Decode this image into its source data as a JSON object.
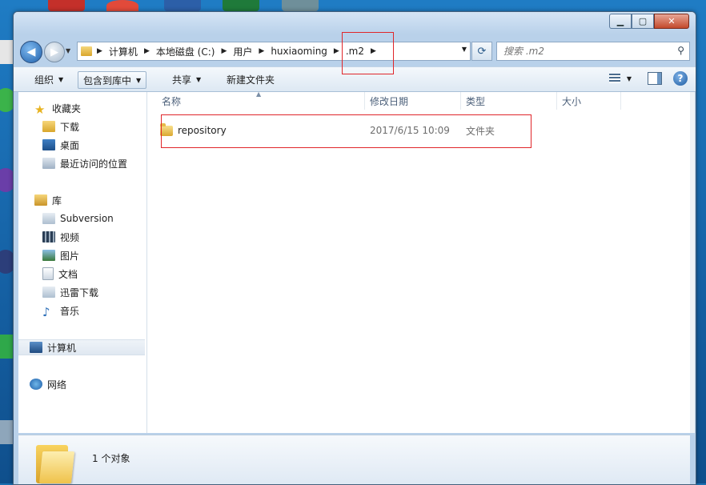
{
  "window": {
    "caption_buttons": [
      "minimize-icon",
      "maximize-icon",
      "close-icon"
    ]
  },
  "address": {
    "crumbs": [
      "计算机",
      "本地磁盘 (C:)",
      "用户",
      "huxiaoming",
      ".m2"
    ]
  },
  "search": {
    "placeholder": "搜索 .m2"
  },
  "toolbar": {
    "organize": "组织",
    "include_library": "包含到库中",
    "share": "共享",
    "new_folder": "新建文件夹"
  },
  "sidebar": {
    "favorites": {
      "label": "收藏夹",
      "items": [
        "下载",
        "桌面",
        "最近访问的位置"
      ]
    },
    "libraries": {
      "label": "库",
      "items": [
        "Subversion",
        "视频",
        "图片",
        "文档",
        "迅雷下载",
        "音乐"
      ]
    },
    "computer": "计算机",
    "network": "网络"
  },
  "columns": {
    "name": "名称",
    "modified": "修改日期",
    "type": "类型",
    "size": "大小"
  },
  "files": [
    {
      "name": "repository",
      "modified": "2017/6/15 10:09",
      "type": "文件夹",
      "size": ""
    }
  ],
  "status": {
    "count": "1 个对象"
  },
  "colors": {
    "highlight": "#e0262a",
    "frame": "#b9d1ea"
  }
}
